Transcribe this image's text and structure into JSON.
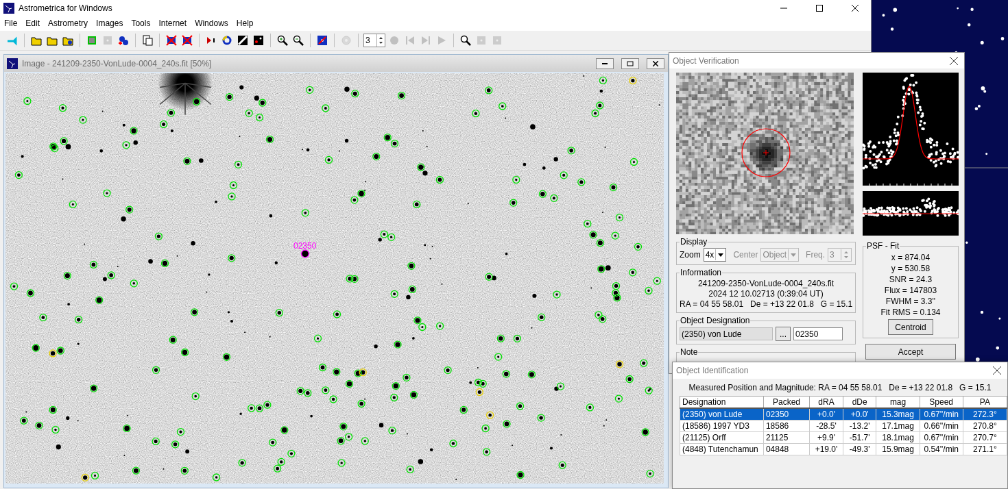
{
  "main_window": {
    "title": "Astrometrica for Windows"
  },
  "menu": [
    "File",
    "Edit",
    "Astrometry",
    "Images",
    "Tools",
    "Internet",
    "Windows",
    "Help"
  ],
  "toolbar": {
    "spin_value": "3",
    "buttons": [
      {
        "disabled": false
      },
      {
        "disabled": false
      },
      {
        "disabled": false
      },
      {
        "disabled": false
      },
      {
        "disabled": false
      },
      {
        "disabled": true
      },
      {
        "disabled": false
      },
      {
        "disabled": false
      },
      {
        "disabled": false
      },
      {
        "disabled": false
      },
      {
        "disabled": false
      },
      {
        "disabled": false
      },
      {
        "disabled": false
      },
      {
        "disabled": false
      },
      {
        "disabled": false
      },
      {
        "disabled": false
      },
      {
        "disabled": false
      },
      {
        "disabled": true
      },
      {
        "disabled": true
      },
      {
        "disabled": true
      },
      {
        "disabled": true
      },
      {
        "disabled": true
      },
      {
        "disabled": false
      },
      {
        "disabled": true
      },
      {
        "disabled": true
      }
    ]
  },
  "image_window": {
    "title": "Image - 241209-2350-VonLude-0004_240s.fit [50%]",
    "target_label": "02350"
  },
  "verification": {
    "title": "Object Verification",
    "display": {
      "legend": "Display",
      "zoom_label": "Zoom",
      "zoom_value": "4x",
      "center_label": "Center",
      "center_value": "Object",
      "center_disabled": true,
      "freq_label": "Freq.",
      "freq_value": "3",
      "freq_disabled": true
    },
    "information": {
      "legend": "Information",
      "lines": [
        "241209-2350-VonLude-0004_240s.fit",
        "2024 12 10.02713 (0:39:04 UT)",
        "RA = 04 55 58.01   De = +13 22 01.8   G = 15.1"
      ]
    },
    "designation": {
      "legend": "Object Designation",
      "name_value": "(2350) von Lude",
      "browse_button": "...",
      "packed_value": "02350"
    },
    "note": {
      "legend": "Note"
    },
    "psf_fit": {
      "legend": "PSF - Fit",
      "lines": [
        "x = 874.04",
        "y = 530.58",
        "SNR = 24.3",
        "Flux = 147803",
        "FWHM = 3.3''",
        "Fit RMS = 0.134"
      ],
      "button": "Centroid"
    },
    "accept_button": "Accept"
  },
  "identification": {
    "title": "Object Identification",
    "measured": "Measured Position and Magnitude: RA = 04 55 58.01   De = +13 22 01.8   G = 15.1",
    "columns": [
      "Designation",
      "Packed",
      "dRA",
      "dDe",
      "mag",
      "Speed",
      "PA"
    ],
    "rows": [
      {
        "selected": true,
        "cells": [
          "(2350) von Lude",
          "02350",
          "+0.0'",
          "+0.0'",
          "15.3mag",
          "0.67''/min",
          "272.3°"
        ]
      },
      {
        "selected": false,
        "cells": [
          "(18586) 1997 YD3",
          "18586",
          "-28.5'",
          "-13.2'",
          "17.1mag",
          "0.66''/min",
          "270.8°"
        ]
      },
      {
        "selected": false,
        "cells": [
          "(21125) Orff",
          "21125",
          "+9.9'",
          "-51.7'",
          "18.1mag",
          "0.67''/min",
          "270.7°"
        ]
      },
      {
        "selected": false,
        "cells": [
          "(4848) Tutenchamun",
          "04848",
          "+19.0'",
          "-49.3'",
          "15.9mag",
          "0.54''/min",
          "271.1°"
        ]
      }
    ]
  }
}
